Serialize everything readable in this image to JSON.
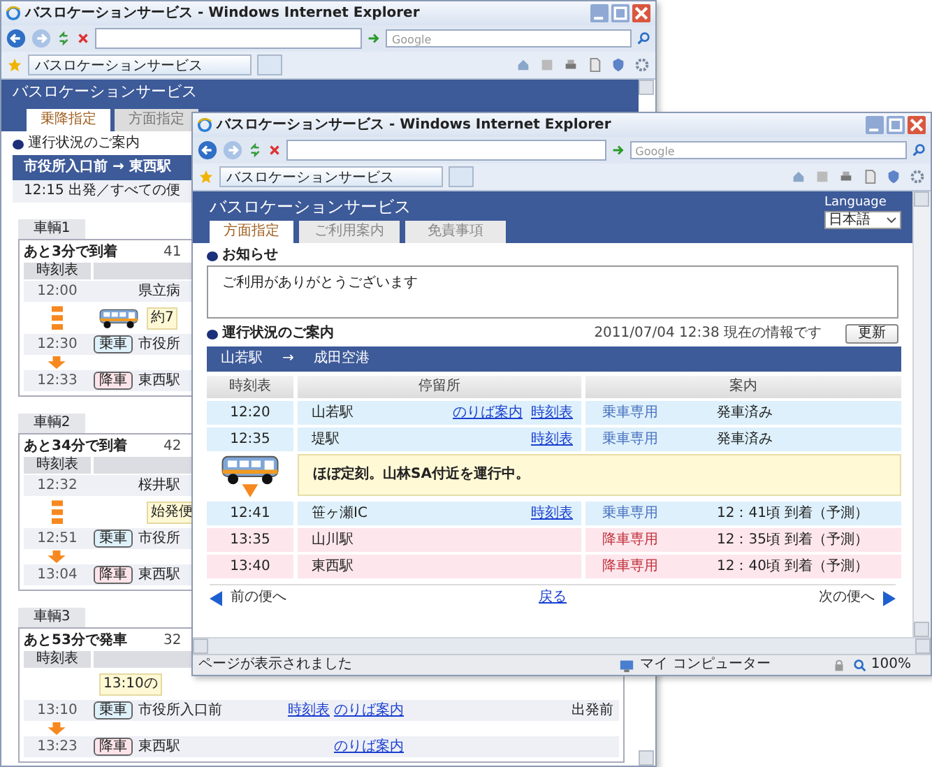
{
  "back_window": {
    "title": "バスロケーションサービス - Windows Internet Explorer",
    "search": {
      "placeholder": "Google"
    },
    "page_tab": "バスロケーションサービス",
    "site_title": "バスロケーションサービス",
    "tabs": [
      {
        "label": "乗降指定",
        "selected": true
      },
      {
        "label": "方面指定",
        "selected": false
      }
    ],
    "section_title": "運行状況のご案内",
    "route": "市役所入口前 → 東西駅",
    "departure": "12:15 出発／すべての便",
    "vehicles": [
      {
        "label": "車輌1",
        "status": "あと3分で到着",
        "number": "41",
        "column": "時刻表",
        "rows": [
          {
            "kind": "stop",
            "time": "12:00",
            "name": "県立病"
          },
          {
            "kind": "bus",
            "note": "約7"
          },
          {
            "kind": "board",
            "time": "12:30",
            "badge": "乗車",
            "name": "市役所"
          },
          {
            "kind": "alight",
            "time": "12:33",
            "badge": "降車",
            "name": "東西駅"
          }
        ]
      },
      {
        "label": "車輌2",
        "status": "あと34分で到着",
        "number": "42",
        "column": "時刻表",
        "rows": [
          {
            "kind": "stop",
            "time": "12:32",
            "name": "桜井駅"
          },
          {
            "kind": "enroute",
            "note": "始発便"
          },
          {
            "kind": "board",
            "time": "12:51",
            "badge": "乗車",
            "name": "市役所"
          },
          {
            "kind": "alight",
            "time": "13:04",
            "badge": "降車",
            "name": "東西駅"
          }
        ]
      },
      {
        "label": "車輌3",
        "status": "あと53分で発車",
        "number": "32",
        "column": "時刻表",
        "rows": [
          {
            "kind": "notice",
            "note": "13:10の"
          },
          {
            "kind": "board",
            "time": "13:10",
            "badge": "乗車",
            "name": "市役所入口前",
            "links": [
              "時刻表",
              "のりば案内"
            ],
            "state": "出発前"
          },
          {
            "kind": "alight",
            "time": "13:23",
            "badge": "降車",
            "name": "東西駅",
            "links": [
              "のりば案内"
            ]
          }
        ]
      }
    ]
  },
  "front_window": {
    "title": "バスロケーションサービス - Windows Internet Explorer",
    "search": {
      "placeholder": "Google"
    },
    "page_tab": "バスロケーションサービス",
    "site_title": "バスロケーションサービス",
    "language": {
      "label": "Language",
      "value": "日本語"
    },
    "tabs": [
      {
        "label": "方面指定",
        "selected": true
      },
      {
        "label": "ご利用案内",
        "selected": false
      },
      {
        "label": "免責事項",
        "selected": false
      }
    ],
    "notice": {
      "title": "お知らせ",
      "text": "ご利用がありがとうございます"
    },
    "status": {
      "title": "運行状況のご案内",
      "timestamp": "2011/07/04 12:38 現在の情報です",
      "refresh": "更新"
    },
    "route": {
      "from": "山若駅",
      "arrow": "→",
      "to": "成田空港"
    },
    "columns": [
      "時刻表",
      "停留所",
      "案内"
    ],
    "rows": [
      {
        "kind": "board",
        "time": "12:20",
        "stop": "山若駅",
        "links": [
          "のりば案内",
          "時刻表"
        ],
        "type": "乗車専用",
        "info": "発車済み"
      },
      {
        "kind": "board",
        "time": "12:35",
        "stop": "堤駅",
        "links": [
          "時刻表"
        ],
        "type": "乗車専用",
        "info": "発車済み"
      },
      {
        "kind": "bus",
        "note": "ほぼ定刻。山林SA付近を運行中。"
      },
      {
        "kind": "board",
        "time": "12:41",
        "stop": "笹ヶ瀬IC",
        "links": [
          "時刻表"
        ],
        "type": "乗車専用",
        "info": "12：41頃 到着（予測）"
      },
      {
        "kind": "alight",
        "time": "13:35",
        "stop": "山川駅",
        "links": [],
        "type": "降車専用",
        "info": "12：35頃 到着（予測）"
      },
      {
        "kind": "alight",
        "time": "13:40",
        "stop": "東西駅",
        "links": [],
        "type": "降車専用",
        "info": "12：40頃 到着（予測）"
      }
    ],
    "nav": {
      "prev": "前の便へ",
      "back": "戻る",
      "next": "次の便へ"
    },
    "status_bar": {
      "message": "ページが表示されました",
      "zone": "マイ コンピューター",
      "zoom": "100%"
    }
  }
}
